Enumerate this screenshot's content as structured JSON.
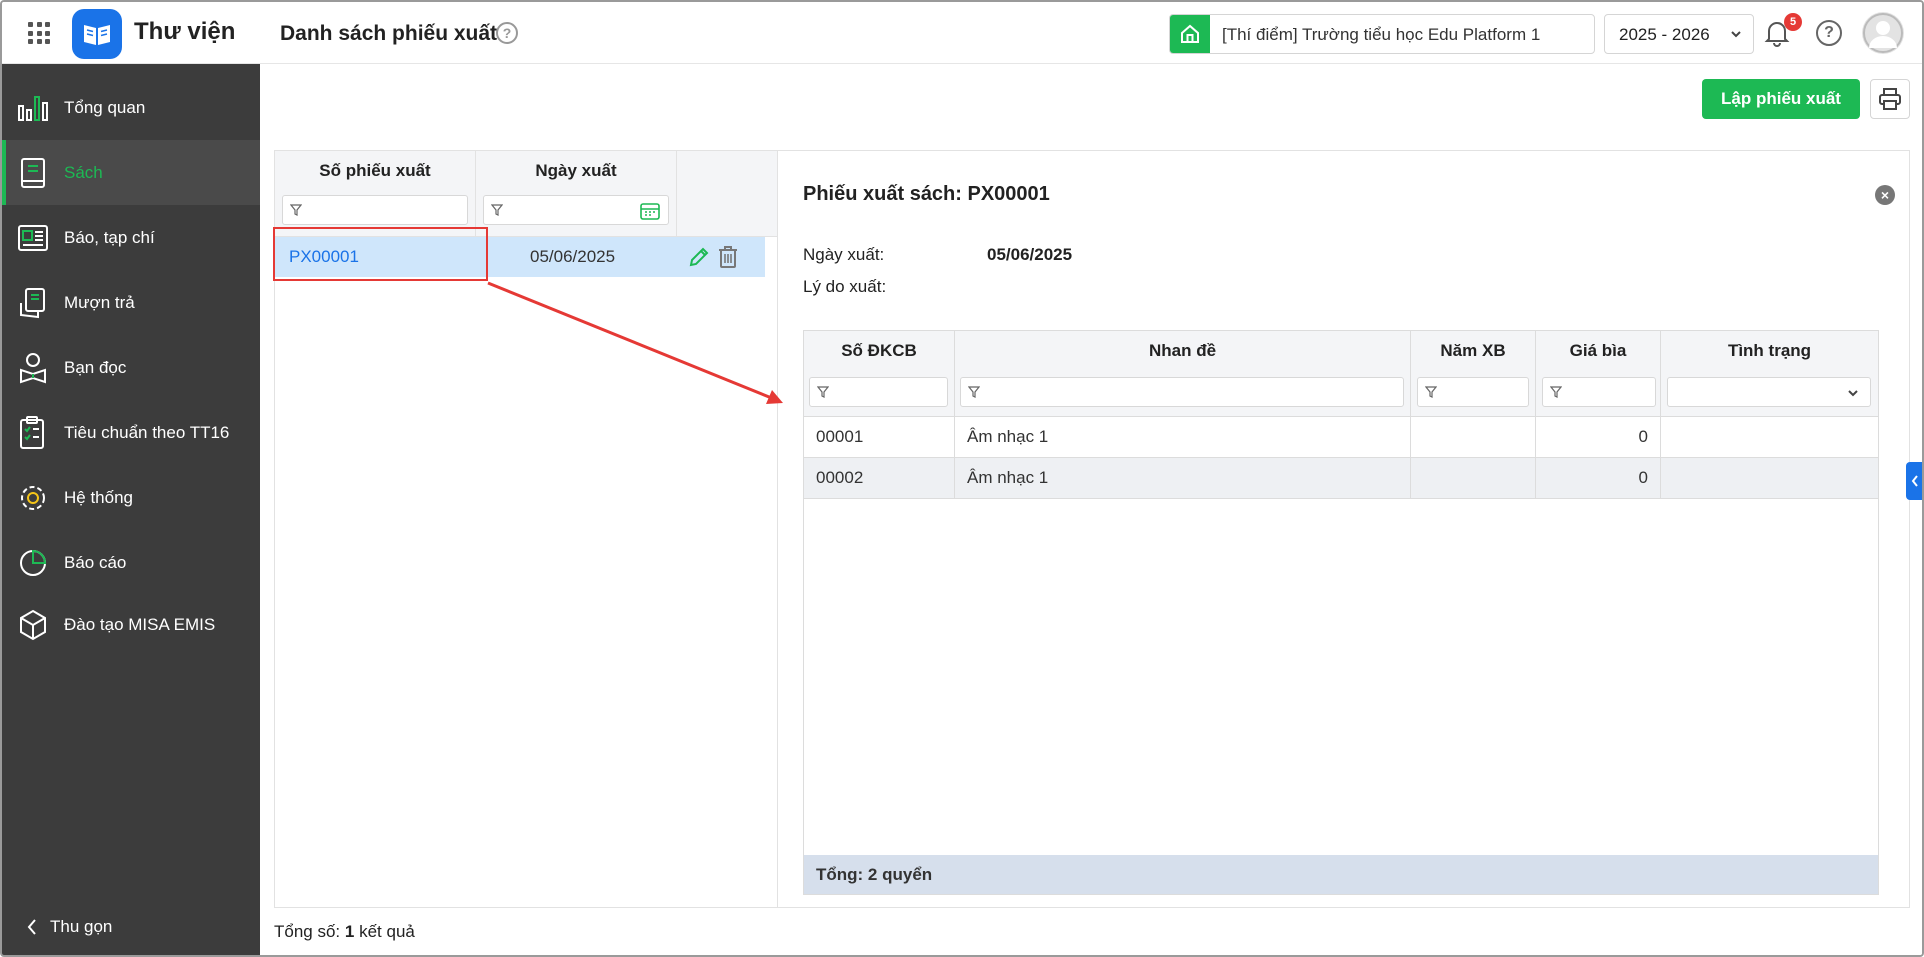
{
  "app": {
    "name": "Thư viện",
    "page_title": "Danh sách phiếu xuất"
  },
  "header": {
    "school": "[Thí điểm] Trường tiểu học Edu Platform 1",
    "year": "2025 - 2026",
    "notification_count": "5"
  },
  "sidebar": {
    "items": [
      {
        "label": "Tổng quan",
        "icon": "chart-bars-icon"
      },
      {
        "label": "Sách",
        "icon": "book-icon",
        "active": true
      },
      {
        "label": "Báo, tạp chí",
        "icon": "newspaper-icon"
      },
      {
        "label": "Mượn trả",
        "icon": "hand-book-icon"
      },
      {
        "label": "Bạn đọc",
        "icon": "reader-icon"
      },
      {
        "label": "Tiêu chuẩn theo TT16",
        "icon": "checklist-icon"
      },
      {
        "label": "Hệ thống",
        "icon": "gear-icon"
      },
      {
        "label": "Báo cáo",
        "icon": "pie-chart-icon"
      },
      {
        "label": "Đào tạo MISA EMIS",
        "icon": "cube-icon"
      }
    ],
    "collapse_label": "Thu gọn"
  },
  "toolbar": {
    "create_label": "Lập phiếu xuất"
  },
  "list": {
    "columns": [
      "Số phiếu xuất",
      "Ngày xuất"
    ],
    "rows": [
      {
        "code": "PX00001",
        "date": "05/06/2025"
      }
    ],
    "footer_prefix": "Tổng số:",
    "footer_count": "1",
    "footer_suffix": "kết quả"
  },
  "detail": {
    "title": "Phiếu xuất sách: PX00001",
    "date_label": "Ngày xuất:",
    "date_value": "05/06/2025",
    "reason_label": "Lý do xuất:",
    "reason_value": "",
    "columns": [
      "Số ĐKCB",
      "Nhan đề",
      "Năm XB",
      "Giá bìa",
      "Tình trạng"
    ],
    "rows": [
      {
        "code": "00001",
        "title": "Âm nhạc 1",
        "year": "",
        "price": "0",
        "status": ""
      },
      {
        "code": "00002",
        "title": "Âm nhạc 1",
        "year": "",
        "price": "0",
        "status": ""
      }
    ],
    "total": "Tổng: 2 quyển"
  },
  "colors": {
    "accent": "#1db954",
    "link": "#1a73e8",
    "sidebar": "#3c3c3c",
    "annotation": "#e53935"
  }
}
